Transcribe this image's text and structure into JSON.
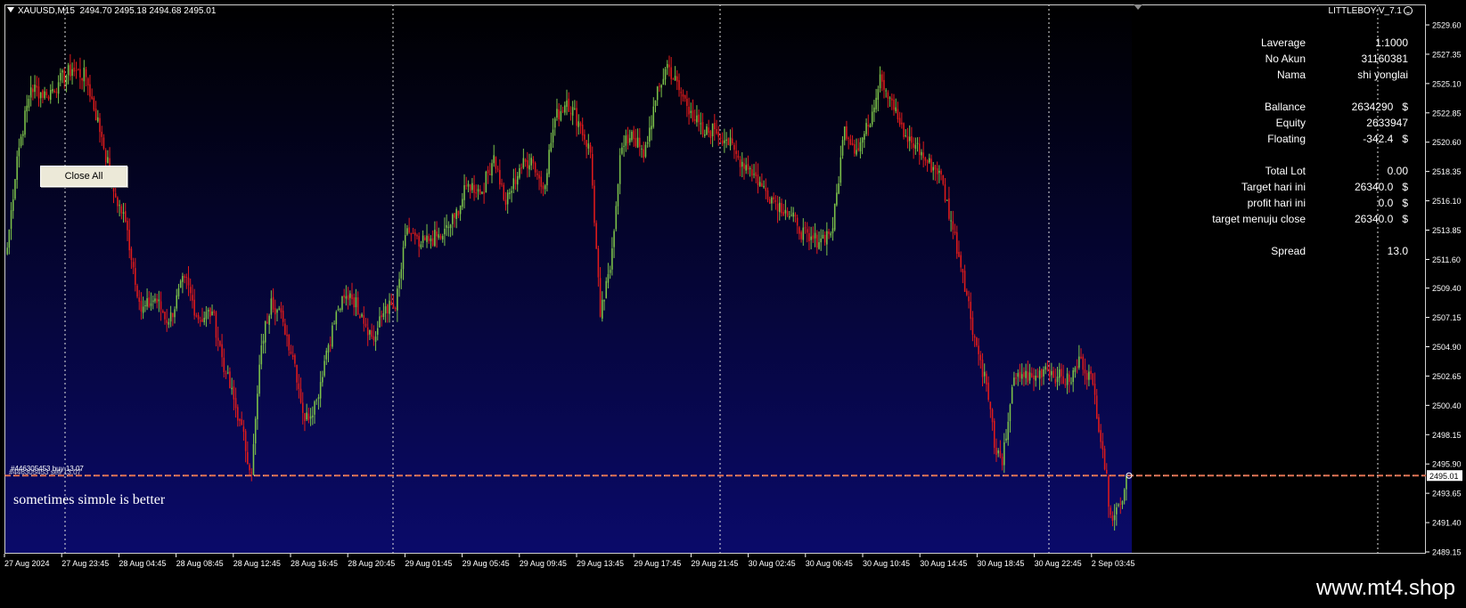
{
  "header": {
    "symbol": "XAUUSD,M15",
    "ohlc": "2494.70 2495.18 2494.68 2495.01"
  },
  "expert": {
    "name": "LITTLEBOY-V_7.1",
    "icon": "smiley-face-icon"
  },
  "info_panel": [
    {
      "label": "Laverage",
      "value": "1:1000",
      "unit": ""
    },
    {
      "label": "No Akun",
      "value": "31160381",
      "unit": ""
    },
    {
      "label": "Nama",
      "value": "shi yonglai",
      "unit": ""
    },
    {
      "label": "Ballance",
      "value": "2634290",
      "unit": "$"
    },
    {
      "label": "Equity",
      "value": "2633947",
      "unit": ""
    },
    {
      "label": "Floating",
      "value": "-342.4",
      "unit": "$"
    },
    {
      "label": "Total Lot",
      "value": "0.00",
      "unit": ""
    },
    {
      "label": "Target hari ini",
      "value": "26340.0",
      "unit": "$"
    },
    {
      "label": "profit hari ini",
      "value": "0.0",
      "unit": "$"
    },
    {
      "label": "target menuju close",
      "value": "26340.0",
      "unit": "$"
    },
    {
      "label": "Spread",
      "value": "13.0",
      "unit": ""
    }
  ],
  "buttons": {
    "close_all": "Close All"
  },
  "order_line_label": "#446305453 buy 13.07",
  "order_line_label_2": "#446305453 sell 13.07",
  "motto": "sometimes simple is better",
  "watermark": "www.mt4.shop",
  "colors": {
    "bull": "#7cc24a",
    "bear": "#e01b1b",
    "price_line": "#e07050",
    "bg_top": "#000000",
    "bg_bottom": "#0a0a6a",
    "axis": "#ffffff"
  },
  "chart_data": {
    "type": "candlestick",
    "symbol": "XAUUSD",
    "timeframe": "M15",
    "y_ticks": [
      "2529.60",
      "2527.35",
      "2525.10",
      "2522.85",
      "2520.60",
      "2518.35",
      "2516.10",
      "2513.85",
      "2511.60",
      "2509.40",
      "2507.15",
      "2504.90",
      "2502.65",
      "2500.40",
      "2498.15",
      "2495.90",
      "2493.65",
      "2491.40",
      "2489.15"
    ],
    "ylim": [
      2489.15,
      2529.6
    ],
    "x_ticks": [
      "27 Aug 2024",
      "27 Aug 23:45",
      "28 Aug 04:45",
      "28 Aug 08:45",
      "28 Aug 12:45",
      "28 Aug 16:45",
      "28 Aug 20:45",
      "29 Aug 01:45",
      "29 Aug 05:45",
      "29 Aug 09:45",
      "29 Aug 13:45",
      "29 Aug 17:45",
      "29 Aug 21:45",
      "30 Aug 02:45",
      "30 Aug 06:45",
      "30 Aug 10:45",
      "30 Aug 14:45",
      "30 Aug 18:45",
      "30 Aug 22:45",
      "2 Sep 03:45"
    ],
    "current_price": "2495.01",
    "close_anchors": [
      [
        0,
        2512.5
      ],
      [
        5,
        2519.5
      ],
      [
        12,
        2524.8
      ],
      [
        20,
        2524.2
      ],
      [
        26,
        2525.2
      ],
      [
        33,
        2526.2
      ],
      [
        40,
        2525.6
      ],
      [
        48,
        2521.0
      ],
      [
        54,
        2516.8
      ],
      [
        60,
        2514.5
      ],
      [
        68,
        2507.6
      ],
      [
        75,
        2508.6
      ],
      [
        82,
        2506.8
      ],
      [
        90,
        2510.2
      ],
      [
        97,
        2507.0
      ],
      [
        104,
        2507.6
      ],
      [
        111,
        2502.8
      ],
      [
        118,
        2499.2
      ],
      [
        124,
        2495.2
      ],
      [
        129,
        2505.0
      ],
      [
        134,
        2508.6
      ],
      [
        140,
        2506.8
      ],
      [
        146,
        2503.6
      ],
      [
        151,
        2499.2
      ],
      [
        157,
        2500.8
      ],
      [
        162,
        2504.6
      ],
      [
        168,
        2507.8
      ],
      [
        174,
        2509.0
      ],
      [
        180,
        2507.4
      ],
      [
        186,
        2505.4
      ],
      [
        192,
        2508.0
      ],
      [
        197,
        2507.8
      ],
      [
        203,
        2514.0
      ],
      [
        209,
        2512.6
      ],
      [
        215,
        2513.2
      ],
      [
        221,
        2513.4
      ],
      [
        227,
        2514.8
      ],
      [
        234,
        2517.4
      ],
      [
        241,
        2516.8
      ],
      [
        247,
        2519.6
      ],
      [
        253,
        2515.8
      ],
      [
        260,
        2518.6
      ],
      [
        266,
        2519.4
      ],
      [
        272,
        2517.0
      ],
      [
        278,
        2522.4
      ],
      [
        284,
        2523.8
      ],
      [
        290,
        2522.2
      ],
      [
        296,
        2519.8
      ],
      [
        301,
        2507.2
      ],
      [
        306,
        2510.8
      ],
      [
        311,
        2519.6
      ],
      [
        317,
        2521.4
      ],
      [
        323,
        2519.4
      ],
      [
        329,
        2523.8
      ],
      [
        335,
        2526.6
      ],
      [
        341,
        2524.6
      ],
      [
        347,
        2523.0
      ],
      [
        353,
        2521.2
      ],
      [
        359,
        2521.6
      ],
      [
        365,
        2520.8
      ],
      [
        371,
        2519.4
      ],
      [
        377,
        2518.6
      ],
      [
        383,
        2517.2
      ],
      [
        389,
        2516.2
      ],
      [
        395,
        2515.4
      ],
      [
        401,
        2514.2
      ],
      [
        407,
        2513.0
      ],
      [
        413,
        2513.2
      ],
      [
        419,
        2514.0
      ],
      [
        425,
        2521.8
      ],
      [
        431,
        2520.0
      ],
      [
        437,
        2521.8
      ],
      [
        443,
        2525.8
      ],
      [
        449,
        2523.8
      ],
      [
        455,
        2521.0
      ],
      [
        461,
        2520.4
      ],
      [
        467,
        2519.0
      ],
      [
        473,
        2518.4
      ],
      [
        479,
        2514.6
      ],
      [
        485,
        2510.6
      ],
      [
        491,
        2505.6
      ],
      [
        497,
        2502.0
      ],
      [
        502,
        2496.6
      ],
      [
        505,
        2495.8
      ],
      [
        510,
        2501.8
      ],
      [
        515,
        2502.8
      ],
      [
        521,
        2502.4
      ],
      [
        527,
        2503.4
      ],
      [
        533,
        2502.6
      ],
      [
        539,
        2502.2
      ],
      [
        545,
        2504.0
      ],
      [
        551,
        2502.0
      ],
      [
        556,
        2497.0
      ],
      [
        560,
        2492.0
      ],
      [
        565,
        2492.8
      ],
      [
        568,
        2495.01
      ]
    ]
  }
}
